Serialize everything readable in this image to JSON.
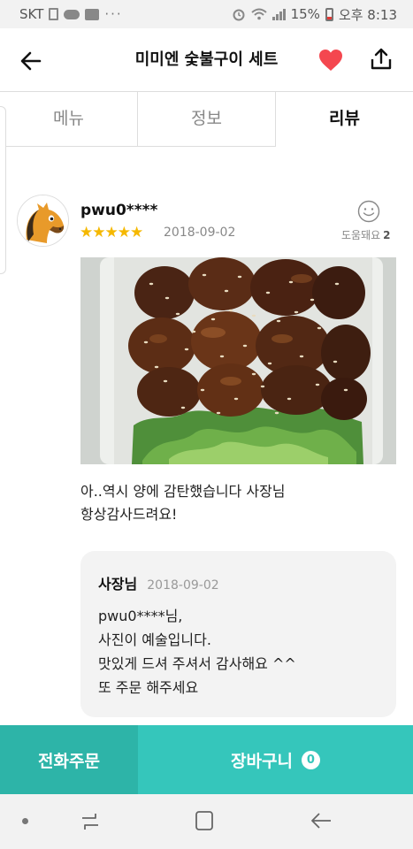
{
  "status_bar": {
    "carrier": "SKT",
    "more": "···",
    "battery": "15%",
    "time": "오후 8:13"
  },
  "header": {
    "title": "미미엔 숯불구이 세트",
    "heart_color": "#f4474f"
  },
  "tabs": [
    {
      "label": "메뉴",
      "active": false
    },
    {
      "label": "정보",
      "active": false
    },
    {
      "label": "리뷰",
      "active": true
    }
  ],
  "review": {
    "username": "pwu0****",
    "stars": "★★★★★",
    "rating": 5,
    "date": "2018-09-02",
    "helpful_label": "도움돼요",
    "helpful_count": "2",
    "text_lines": [
      "아..역시 양에 감탄했습니다 사장님",
      "항상감사드려요!"
    ]
  },
  "reply": {
    "author": "사장님",
    "date": "2018-09-02",
    "lines": [
      "pwu0****님,",
      "사진이 예술입니다.",
      "맛있게 드셔 주셔서 감사해요 ^^",
      "또 주문 해주세요"
    ]
  },
  "bottom": {
    "phone_order": "전화주문",
    "cart": "장바구니",
    "cart_count": "0"
  },
  "colors": {
    "accent": "#35c6bb",
    "accent_dark": "#2db4a8",
    "star": "#f5b800"
  },
  "icons": {
    "back": "arrow-left-icon",
    "favorite": "heart-icon",
    "share": "share-icon",
    "helpful": "smiley-icon"
  }
}
